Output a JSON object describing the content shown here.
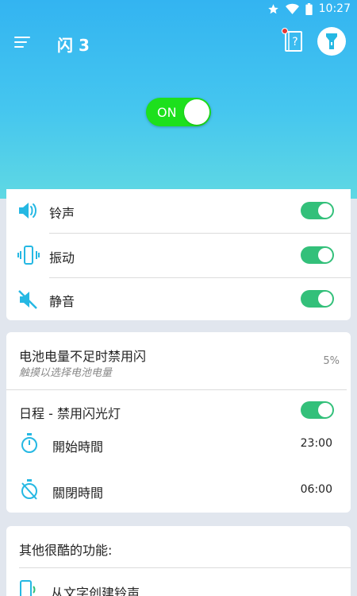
{
  "status_bar": {
    "time": "10:27",
    "icons": [
      "star-icon",
      "wifi-icon",
      "battery-icon"
    ]
  },
  "header": {
    "title": "闪 3",
    "menu_icon": "hamburger-menu-icon",
    "help_icon": "help-book-icon",
    "torch_icon": "flashlight-icon"
  },
  "main_switch": {
    "label": "ON",
    "state": "on"
  },
  "alerts": {
    "items": [
      {
        "label": "铃声",
        "icon": "speaker-icon",
        "enabled": true
      },
      {
        "label": "振动",
        "icon": "vibrate-icon",
        "enabled": true
      },
      {
        "label": "静音",
        "icon": "mute-icon",
        "enabled": true
      }
    ]
  },
  "battery": {
    "label": "电池电量不足时禁用闪",
    "hint": "触摸以选择电池电量",
    "value": "5%"
  },
  "schedule": {
    "label": "日程 - 禁用闪光灯",
    "enabled": true,
    "start_label": "開始時間",
    "start_value": "23:00",
    "end_label": "關閉時間",
    "end_value": "06:00"
  },
  "more": {
    "title": "其他很酷的功能:",
    "item_label": "从文字创建铃声"
  },
  "colors": {
    "accent": "#33b4f1",
    "toggle_on": "#33c07a",
    "main_switch": "#1de01d",
    "icon": "#25b8e3"
  }
}
